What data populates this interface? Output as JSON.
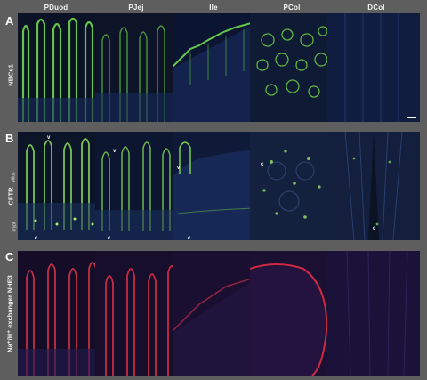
{
  "columns": [
    "PDuod",
    "PJej",
    "Ile",
    "PCol",
    "DCol"
  ],
  "rows": [
    {
      "letter": "A",
      "label": "NBCe1",
      "color": "#7de35a"
    },
    {
      "letter": "B",
      "label": "CFTR",
      "color": "#86e24e"
    },
    {
      "letter": "C",
      "label": "Na⁺/H⁺ exchanger  NHE3",
      "color": "#e4284a"
    }
  ],
  "side_labels": {
    "villus": "villus",
    "crypt": "crypt"
  },
  "annotations": {
    "v": "v",
    "c": "c"
  },
  "colors": {
    "nuclear_stain": "#1f3f8a",
    "background": "#5e5e5e"
  }
}
